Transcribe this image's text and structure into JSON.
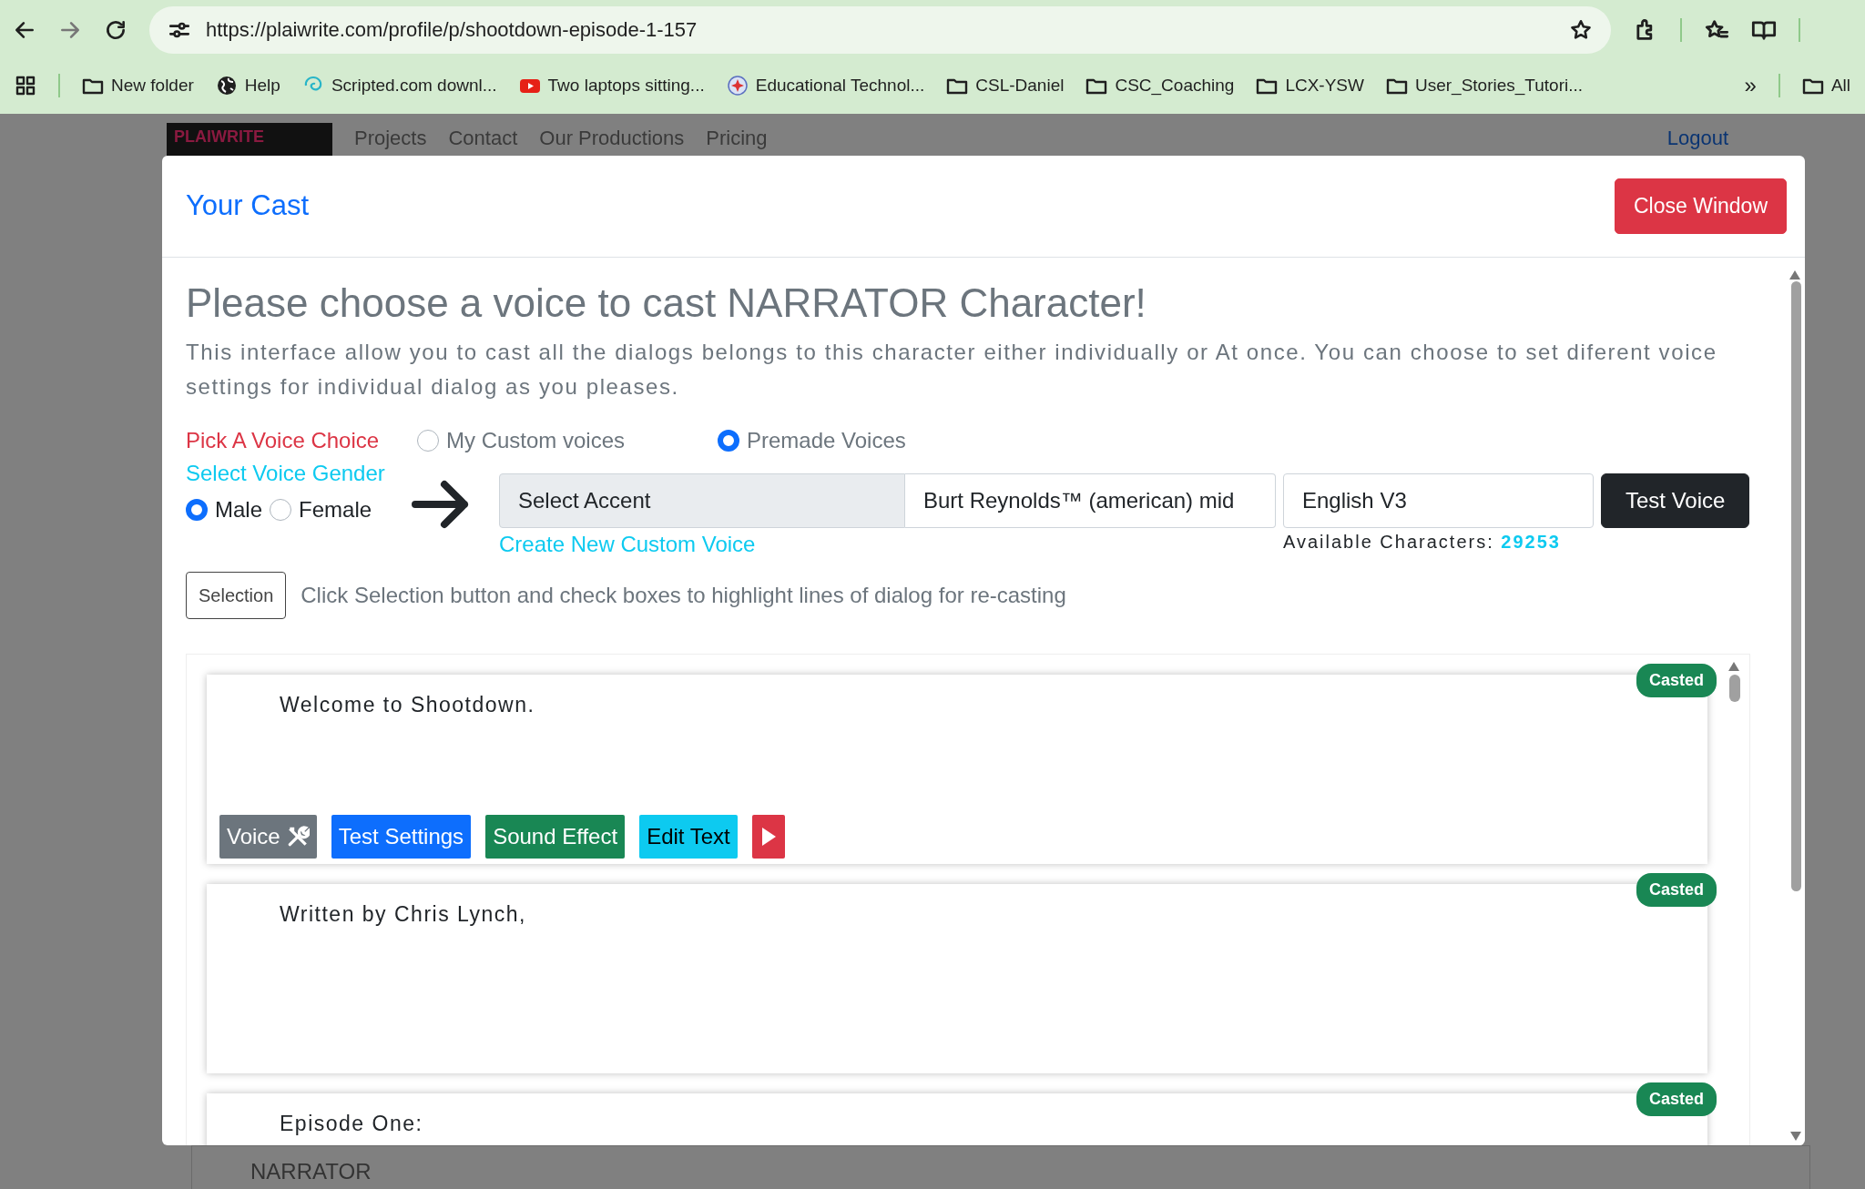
{
  "browser": {
    "url": "https://plaiwrite.com/profile/p/shootdown-episode-1-157",
    "bookmarks": [
      {
        "label": "New folder",
        "kind": "folder"
      },
      {
        "label": "Help",
        "kind": "globe"
      },
      {
        "label": "Scripted.com downl...",
        "kind": "swirl"
      },
      {
        "label": "Two laptops sitting...",
        "kind": "video"
      },
      {
        "label": "Educational Technol...",
        "kind": "badge"
      },
      {
        "label": "CSL-Daniel",
        "kind": "folder"
      },
      {
        "label": "CSC_Coaching",
        "kind": "folder"
      },
      {
        "label": "LCX-YSW",
        "kind": "folder"
      },
      {
        "label": "User_Stories_Tutori...",
        "kind": "folder"
      }
    ],
    "more": "»",
    "all_bookmarks": "All"
  },
  "page": {
    "logo": "PLAIWRITE",
    "nav": [
      "Projects",
      "Contact",
      "Our Productions",
      "Pricing"
    ],
    "logout": "Logout",
    "footer_label": "NARRATOR"
  },
  "modal": {
    "title": "Your Cast",
    "close_button": "Close Window",
    "heading": "Please choose a voice to cast NARRATOR Character!",
    "description": "This interface allow you to cast all the dialogs belongs to this character either individually or At once. You can choose to set diferent voice settings for individual dialog as you pleases.",
    "voice_choice": {
      "label": "Pick A Voice Choice",
      "options": [
        {
          "label": "My Custom voices",
          "selected": false
        },
        {
          "label": "Premade Voices",
          "selected": true
        }
      ]
    },
    "gender": {
      "label": "Select Voice Gender",
      "options": [
        {
          "label": "Male",
          "selected": true
        },
        {
          "label": "Female",
          "selected": false
        }
      ]
    },
    "accent": "Select Accent",
    "voice": "Burt Reynolds™ (american) mid",
    "model": "English V3",
    "test_button": "Test Voice",
    "create_link": "Create New Custom Voice",
    "available_label": "Available Characters:",
    "available_count": "29253",
    "selection_button": "Selection",
    "selection_hint": "Click Selection button and check boxes to highlight lines of dialog for re-casting",
    "dialogs": [
      {
        "text": "Welcome to Shootdown.",
        "badge": "Casted",
        "buttons": [
          {
            "label": "Voice",
            "kind": "voice"
          },
          {
            "label": "Test Settings",
            "kind": "primary"
          },
          {
            "label": "Sound Effect",
            "kind": "success"
          },
          {
            "label": "Edit Text",
            "kind": "info"
          },
          {
            "kind": "play"
          }
        ]
      },
      {
        "text": "Written by Chris Lynch,",
        "badge": "Casted"
      },
      {
        "text": "Episode One:",
        "badge": "Casted"
      }
    ]
  }
}
